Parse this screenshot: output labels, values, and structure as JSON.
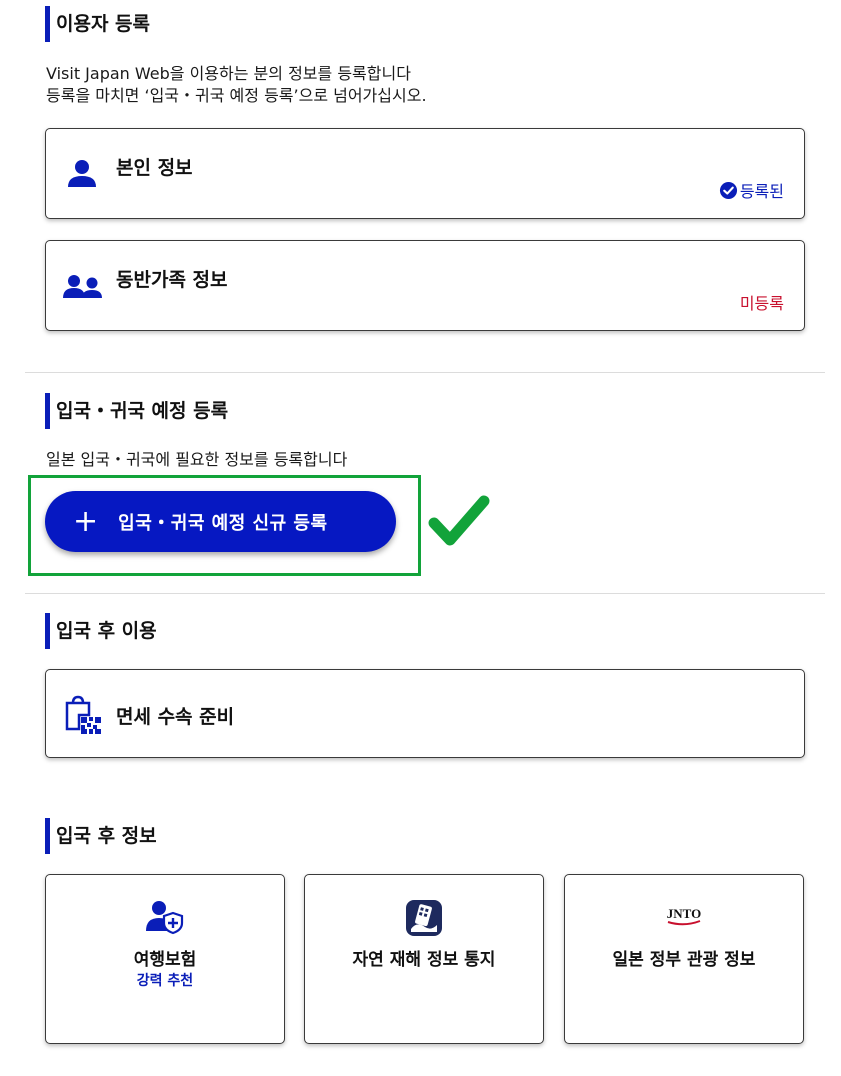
{
  "registration": {
    "title": "이용자 등록",
    "desc_line1": "Visit Japan Web을 이용하는 분의 정보를 등록합니다",
    "desc_line2": "등록을 마치면 ‘입국・귀국 예정 등록’으로 넘어가십시오.",
    "self_info": {
      "label": "본인 정보",
      "status": "등록된",
      "status_color": "#0a1eb8"
    },
    "family_info": {
      "label": "동반가족 정보",
      "status": "미등록",
      "status_color": "#c8102e"
    }
  },
  "entry": {
    "title": "입국・귀국 예정 등록",
    "desc": "일본 입국・귀국에 필요한 정보를 등록합니다",
    "button_icon": "plus-icon",
    "button_label": "입국・귀국 예정 신규 등록",
    "button_color": "#0618c2",
    "annotation": {
      "box_color": "#12a33a",
      "icon": "check-mark-icon"
    }
  },
  "after_use": {
    "title": "입국 후 이용",
    "tax_free": {
      "label": "면세 수속 준비",
      "icon": "tax-free-qr-icon"
    }
  },
  "after_info": {
    "title": "입국 후 정보",
    "tiles": [
      {
        "label": "여행보험",
        "sub": "강력 추천",
        "icon": "insurance-shield-icon"
      },
      {
        "label": "자연 재해 정보 통지",
        "icon": "safety-tips-app-icon"
      },
      {
        "label": "일본 정부 관광 정보",
        "icon": "jnto-logo"
      }
    ],
    "jnto_logo_text": "JNTO"
  }
}
